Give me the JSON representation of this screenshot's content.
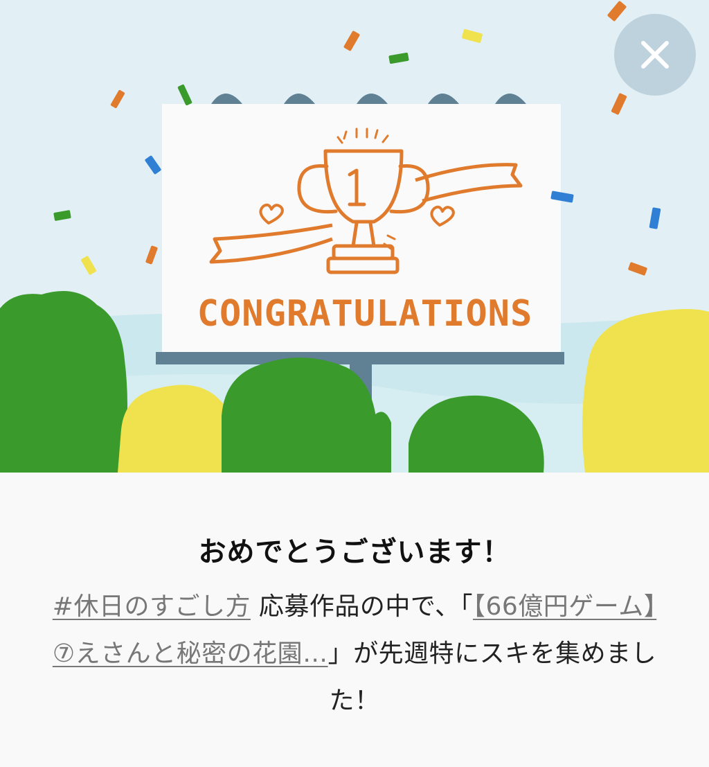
{
  "hero": {
    "billboard_text": "CONGRATULATIONS",
    "trophy_rank": "1"
  },
  "close_button": {
    "icon": "close-icon",
    "label": "×"
  },
  "content": {
    "title": "おめでとうございます！",
    "hashtag_link": "#休日のすごし方",
    "message_mid": " 応募作品の中で、「",
    "article_link": "【66億円ゲーム】⑦えさんと秘密の花園…",
    "message_end": "」が先週特にスキを集めました！"
  },
  "colors": {
    "accent_orange": "#e07b2e",
    "tree_green": "#3a9a2c",
    "tree_yellow": "#f0e24e",
    "sky": "#e2f0f6"
  }
}
